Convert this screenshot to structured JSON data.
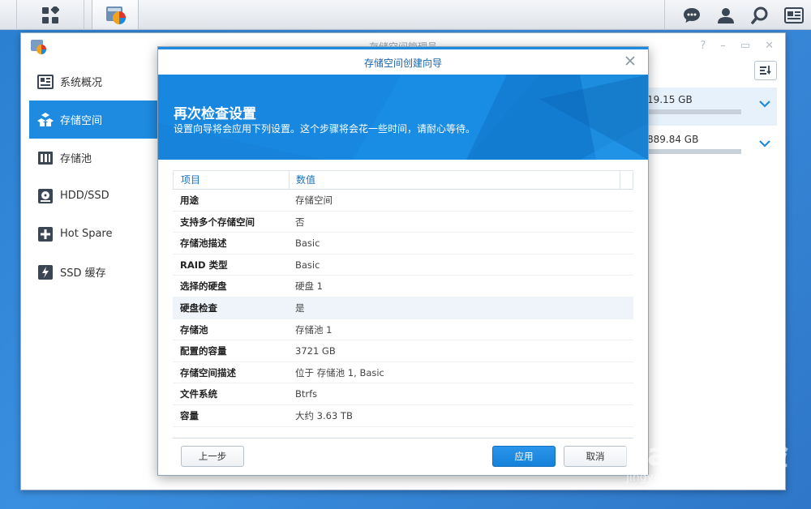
{
  "window": {
    "title": "存储空间管理员"
  },
  "sidebar": {
    "items": [
      {
        "label": "系统概况",
        "icon": "overview-icon"
      },
      {
        "label": "存储空间",
        "icon": "volume-icon"
      },
      {
        "label": "存储池",
        "icon": "storage-pool-icon"
      },
      {
        "label": "HDD/SSD",
        "icon": "hdd-icon"
      },
      {
        "label": "Hot Spare",
        "icon": "hot-spare-icon"
      },
      {
        "label": "SSD 缓存",
        "icon": "ssd-cache-icon"
      }
    ],
    "active_index": 1
  },
  "volumes": [
    {
      "size": "19.15 GB",
      "usage_fraction": 0.0
    },
    {
      "size": "889.84 GB",
      "usage_fraction": 0.0
    }
  ],
  "wizard": {
    "title": "存储空间创建向导",
    "heading": "再次检查设置",
    "subheading": "设置向导将会应用下列设置。这个步骤将会花一些时间，请耐心等待。",
    "columns": {
      "item": "项目",
      "value": "数值"
    },
    "rows": [
      {
        "item": "用途",
        "value": "存储空间"
      },
      {
        "item": "支持多个存储空间",
        "value": "否"
      },
      {
        "item": "存储池描述",
        "value": "Basic"
      },
      {
        "item": "RAID 类型",
        "value": "Basic"
      },
      {
        "item": "选择的硬盘",
        "value": "硬盘 1"
      },
      {
        "item": "硬盘检查",
        "value": "是"
      },
      {
        "item": "存储池",
        "value": "存储池 1"
      },
      {
        "item": "配置的容量",
        "value": "3721 GB"
      },
      {
        "item": "存储空间描述",
        "value": "位于 存储池 1, Basic"
      },
      {
        "item": "文件系统",
        "value": "Btrfs"
      },
      {
        "item": "容量",
        "value": "大约 3.63 TB"
      }
    ],
    "highlighted_row": 5,
    "buttons": {
      "prev": "上一步",
      "apply": "应用",
      "cancel": "取消"
    }
  },
  "watermark": {
    "text": "Baidu经验",
    "sub": "jingyan.baidu.com"
  },
  "colors": {
    "accent": "#1e8be0",
    "banner": "#1787df",
    "desktop": "#2f83d6"
  }
}
